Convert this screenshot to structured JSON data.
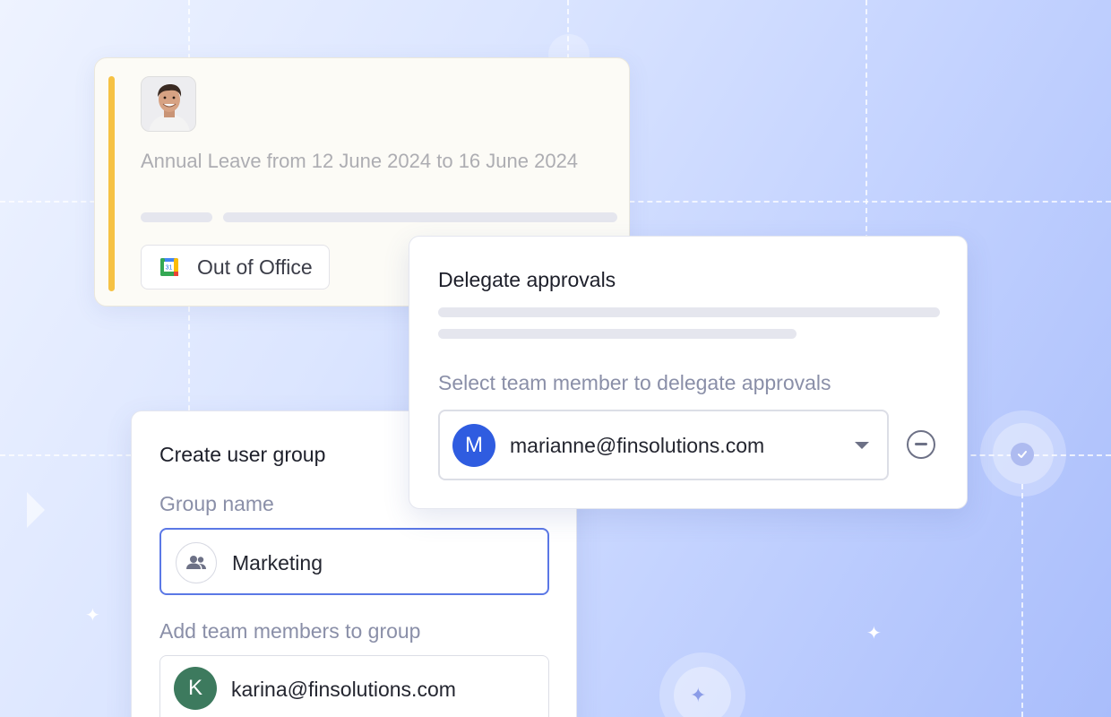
{
  "leave_card": {
    "text": "Annual Leave from 12 June 2024 to 16 June 2024",
    "status_chip": "Out of Office",
    "calendar_icon_day": "31"
  },
  "delegate_card": {
    "title": "Delegate approvals",
    "field_label": "Select team member to delegate approvals",
    "selected_member": {
      "initial": "M",
      "email": "marianne@finsolutions.com",
      "avatar_color": "#2f5ce0"
    }
  },
  "group_card": {
    "title": "Create user group",
    "group_name_label": "Group name",
    "group_name_value": "Marketing",
    "members_label": "Add team members to group",
    "member": {
      "initial": "K",
      "email": "karina@finsolutions.com",
      "avatar_color": "#3d7a5e"
    }
  },
  "colors": {
    "accent_yellow": "#f6c244",
    "focus_blue": "#5b78e6"
  },
  "icons": [
    "user-photo",
    "google-calendar-icon",
    "chevron-down-icon",
    "remove-circle-icon",
    "people-icon",
    "check-circle-icon",
    "sparkle-icon",
    "play-triangle"
  ]
}
